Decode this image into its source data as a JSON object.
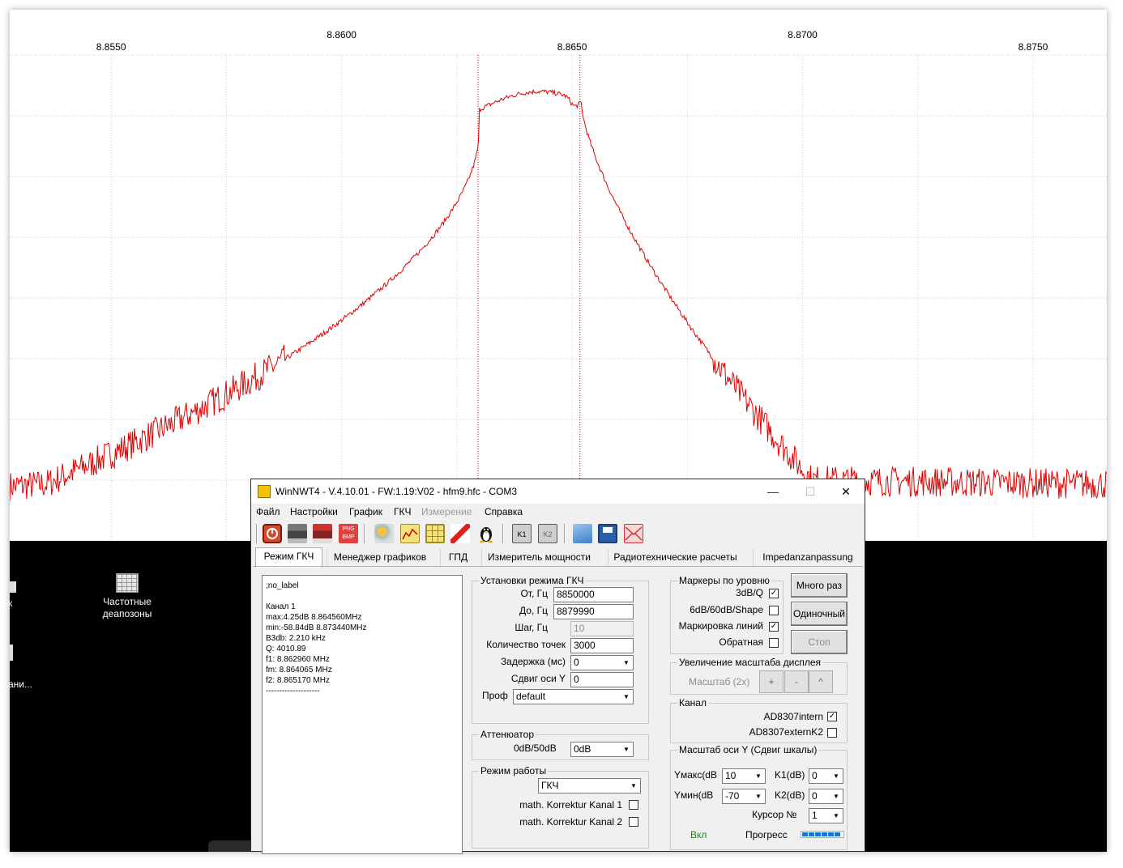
{
  "plot": {
    "x_ticks": [
      {
        "freq": 8.855,
        "label": "8.8550",
        "row": "low"
      },
      {
        "freq": 8.86,
        "label": "8.8600",
        "row": "high"
      },
      {
        "freq": 8.865,
        "label": "8.8650",
        "row": "low"
      },
      {
        "freq": 8.87,
        "label": "8.8700",
        "row": "high"
      },
      {
        "freq": 8.875,
        "label": "8.8750",
        "row": "low"
      }
    ],
    "x_range_mhz": [
      8.8528,
      8.8766
    ],
    "y_range_db": [
      -70,
      10
    ],
    "trace_color": "#e00000",
    "marker_color": "#e00000",
    "marker_lines_mhz": [
      8.86296,
      8.86517
    ]
  },
  "desktop": {
    "icon_label_line1": "Частотные",
    "icon_label_line2": "деапозоны",
    "partial_label_1": "к",
    "partial_label_2": "ани..."
  },
  "window": {
    "title": "WinNWT4 - V.4.10.01 - FW:1.19:V02 - hfm9.hfc - COM3",
    "minimize": "—",
    "maximize": "☐",
    "close": "✕"
  },
  "menu": [
    "Файл",
    "Настройки",
    "График",
    "ГКЧ",
    "Измерение",
    "Справка"
  ],
  "menu_disabled_index": 4,
  "tabs": [
    "Режим ГКЧ",
    "Менеджер графиков",
    "ГПД",
    "Измеритель мощности",
    "Радиотехнические расчеты",
    "Impedanzanpassung"
  ],
  "results_text": ";no_label\n\nКанал 1\nmax:4.25dB 8.864560MHz\nmin:-58.84dB 8.873440MHz\nB3db: 2.210 kHz\nQ: 4010.89\nf1: 8.862960 MHz\nfm: 8.864065 MHz\nf2: 8.865170 MHz\n--------------------",
  "sweep": {
    "title": "Установки режима ГКЧ",
    "from_label": "От, Гц",
    "from_value": "8850000",
    "to_label": "До, Гц",
    "to_value": "8879990",
    "step_label": "Шаг, Гц",
    "step_value": "10",
    "points_label": "Количество точек",
    "points_value": "3000",
    "delay_label": "Задержка (мс)",
    "delay_value": "0",
    "shift_label": "Сдвиг оси Y",
    "shift_value": "0",
    "profile_label": "Проф",
    "profile_value": "default"
  },
  "attenuator": {
    "title": "Аттенюатор",
    "label": "0dB/50dB",
    "value": "0dB"
  },
  "mode": {
    "title": "Режим работы",
    "value": "ГКЧ",
    "corr1": "math. Korrektur Kanal 1",
    "corr2": "math. Korrektur Kanal 2"
  },
  "markers": {
    "title": "Маркеры по уровню",
    "m1": "3dB/Q",
    "m2": "6dB/60dB/Shape",
    "m3": "Маркировка линий",
    "m4": "Обратная"
  },
  "run_buttons": {
    "multi": "Много раз",
    "single": "Одиночный",
    "stop": "Стоп"
  },
  "zoom": {
    "title": "Увеличение масштаба дисплея",
    "label": "Масштаб (2x)",
    "plus": "+",
    "minus": "-",
    "up": "^"
  },
  "channel": {
    "title": "Канал",
    "intern": "AD8307intern",
    "extern": "AD8307externK2"
  },
  "yscale": {
    "title": "Масштаб оси Y (Сдвиг шкалы)",
    "ymax_label": "Yмакс(dB",
    "ymax_value": "10",
    "ymin_label": "Yмин(dB",
    "ymin_value": "-70",
    "k1_label": "K1(dB)",
    "k1_value": "0",
    "k2_label": "K2(dB)",
    "k2_value": "0",
    "cursor_label": "Курсор №",
    "cursor_value": "1",
    "on_label": "Вкл",
    "progress_label": "Прогресс",
    "on_color": "#1a8a1a"
  }
}
